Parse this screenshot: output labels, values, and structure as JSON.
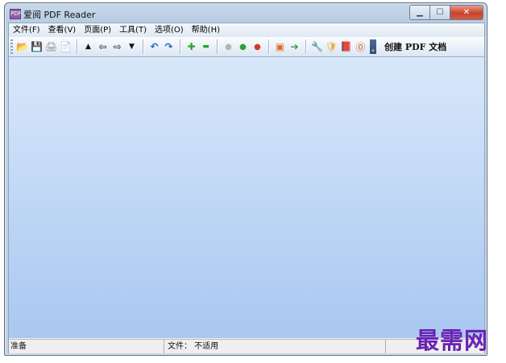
{
  "window": {
    "title": "爱阅 PDF Reader",
    "icon": "reader-app-icon"
  },
  "window_buttons": {
    "minimize": "▁",
    "maximize": "☐",
    "close": "✕"
  },
  "menu": [
    "文件(F)",
    "查看(V)",
    "页面(P)",
    "工具(T)",
    "选项(O)",
    "帮助(H)"
  ],
  "toolbar": {
    "icons": {
      "open": "📂",
      "save": "💾",
      "print": "🖨",
      "copy": "📄",
      "up": "▲",
      "left": "⇦",
      "right": "⇨",
      "down": "▼",
      "undo": "↶",
      "redo": "↷",
      "zoom_in": "✚",
      "zoom_out": "▬",
      "circle_gray": "●",
      "circle_green": "●",
      "circle_red": "●",
      "page_view": "▣",
      "export": "➔",
      "tool": "🔧",
      "shield": "🛡",
      "book": "📕",
      "info": "⓪"
    },
    "overflow": "»",
    "create_pdf_label": "创建 PDF 文档"
  },
  "status": {
    "ready": "准备",
    "file": "文件： 不适用"
  },
  "watermark": "最需网",
  "colors": {
    "accent": "#6a22b4",
    "content_top": "#d8e8fb",
    "content_bottom": "#a9c7f0"
  }
}
